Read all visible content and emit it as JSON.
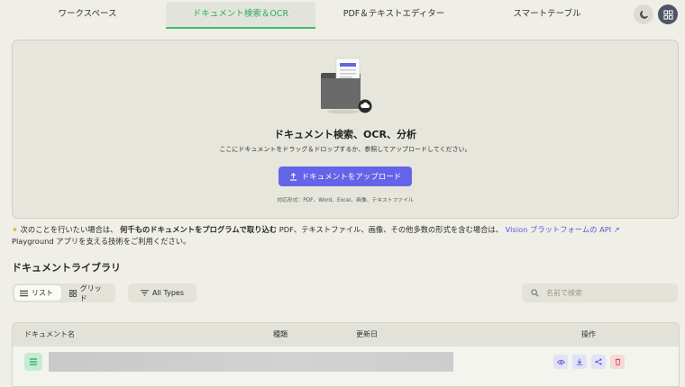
{
  "nav": {
    "tabs": [
      {
        "label": "ワークスペース"
      },
      {
        "label": "ドキュメント検索＆OCR",
        "active": true
      },
      {
        "label": "PDF＆テキストエディター"
      },
      {
        "label": "スマートテーブル"
      }
    ]
  },
  "dropzone": {
    "title": "ドキュメント検索、OCR、分析",
    "subtitle": "ここにドキュメントをドラッグ＆ドロップするか、参照してアップロードしてください。",
    "upload_label": "ドキュメントをアップロード",
    "formats": "対応形式：PDF、Word、Excel、画像、テキストファイル"
  },
  "info": {
    "prefix": "次のことを行いたい場合は、",
    "bold": "何千ものドキュメントをプログラムで取り込む",
    "middle": " PDF、テキストファイル、画像、その他多数の形式を含む場合は、",
    "link": "Vision プラットフォームの API ↗",
    "suffix": "Playground アプリを支える技術をご利用ください。"
  },
  "library": {
    "title": "ドキュメントライブラリ",
    "view_list": "リスト",
    "view_grid": "グリッド",
    "types_filter": "All Types",
    "search_placeholder": "名前で検索"
  },
  "table": {
    "headers": {
      "name": "ドキュメント名",
      "type": "種類",
      "updated": "更新日",
      "actions": "操作"
    }
  },
  "colors": {
    "accent": "#6464e8",
    "active_tab": "#2cae5f",
    "delete": "#d84a4a"
  },
  "icons": [
    "moon-icon",
    "grid-icon",
    "upload-icon",
    "list-icon",
    "filter-icon",
    "search-icon",
    "eye-icon",
    "download-icon",
    "share-icon",
    "trash-icon"
  ]
}
